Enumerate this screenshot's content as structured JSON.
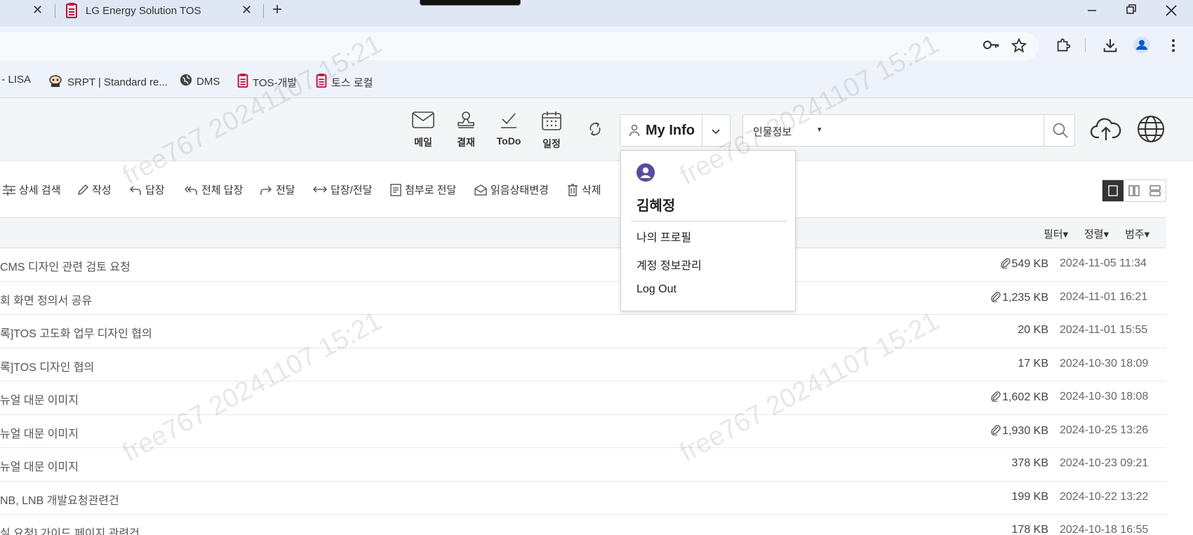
{
  "browser": {
    "active_tab_title": "LG Energy Solution TOS",
    "tab_close_glyph": "✕",
    "new_tab_glyph": "+",
    "bookmarks": [
      {
        "icon": "globe-icon",
        "label": "! - LISA"
      },
      {
        "icon": "robot-icon",
        "label": "SRPT | Standard re..."
      },
      {
        "icon": "globe-icon",
        "label": "DMS"
      },
      {
        "icon": "doc-icon",
        "label": "TOS-개발"
      },
      {
        "icon": "doc-icon",
        "label": "토스 로컬"
      }
    ]
  },
  "header": {
    "icons": [
      {
        "name": "mail",
        "label": "메일"
      },
      {
        "name": "approval",
        "label": "결재"
      },
      {
        "name": "todo",
        "label": "ToDo"
      },
      {
        "name": "schedule",
        "label": "일정"
      }
    ],
    "myinfo_label": "My Info",
    "search_scope": "인물정보",
    "search_scope_caret": "▾"
  },
  "toolbar": {
    "items": [
      "상세 검색",
      "작성",
      "답장",
      "전체 답장",
      "전달",
      "답장/전달",
      "첨부로 전달",
      "읽음상태변경",
      "삭제"
    ]
  },
  "list": {
    "filters": [
      "필터▾",
      "정렬▾",
      "범주▾"
    ],
    "rows": [
      {
        "subject": "CMS 디자인 관련 검토 요청",
        "attachment": true,
        "size": "549 KB",
        "date": "2024-11-05 11:34"
      },
      {
        "subject": "회 화면 정의서 공유",
        "attachment": true,
        "size": "1,235 KB",
        "date": "2024-11-01 16:21"
      },
      {
        "subject": "록]TOS 고도화 업무 디자인 협의",
        "attachment": false,
        "size": "20 KB",
        "date": "2024-11-01 15:55"
      },
      {
        "subject": "록]TOS 디자인 협의",
        "attachment": false,
        "size": "17 KB",
        "date": "2024-10-30 18:09"
      },
      {
        "subject": "뉴얼 대문 이미지",
        "attachment": true,
        "size": "1,602 KB",
        "date": "2024-10-30 18:08"
      },
      {
        "subject": "뉴얼 대문 이미지",
        "attachment": true,
        "size": "1,930 KB",
        "date": "2024-10-25 13:26"
      },
      {
        "subject": "뉴얼 대문 이미지",
        "attachment": false,
        "size": "378 KB",
        "date": "2024-10-23 09:21"
      },
      {
        "subject": "NB, LNB 개발요청관련건",
        "attachment": false,
        "size": "199 KB",
        "date": "2024-10-22 13:22"
      },
      {
        "subject": "실 요청] 가이드 페이지 관련건",
        "attachment": false,
        "size": "178 KB",
        "date": "2024-10-18 16:55"
      }
    ]
  },
  "dropdown": {
    "user_name": "김혜정",
    "items": [
      "나의 프로필",
      "계정 정보관리",
      "Log Out"
    ]
  },
  "watermark": "free767 20241107 15:21",
  "colors": {
    "avatar": "#5b4a9e",
    "doc_icon": "#c0143c",
    "accent_dark": "#333333"
  }
}
